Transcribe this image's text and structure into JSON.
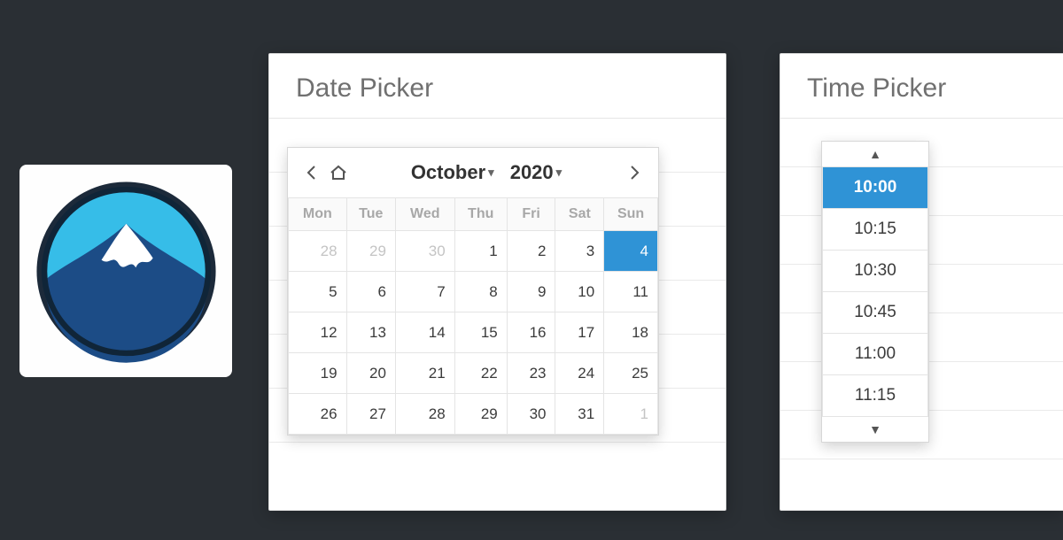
{
  "colors": {
    "accent": "#2f93d6"
  },
  "logo": {
    "name": "mountain-logo"
  },
  "date_picker": {
    "title": "Date Picker",
    "month_label": "October",
    "year_label": "2020",
    "selected_day": 4,
    "weekday_headers": [
      "Mon",
      "Tue",
      "Wed",
      "Thu",
      "Fri",
      "Sat",
      "Sun"
    ],
    "weeks": [
      [
        {
          "d": 28,
          "other": true
        },
        {
          "d": 29,
          "other": true
        },
        {
          "d": 30,
          "other": true
        },
        {
          "d": 1
        },
        {
          "d": 2
        },
        {
          "d": 3
        },
        {
          "d": 4,
          "selected": true
        }
      ],
      [
        {
          "d": 5
        },
        {
          "d": 6
        },
        {
          "d": 7
        },
        {
          "d": 8
        },
        {
          "d": 9
        },
        {
          "d": 10
        },
        {
          "d": 11
        }
      ],
      [
        {
          "d": 12
        },
        {
          "d": 13
        },
        {
          "d": 14
        },
        {
          "d": 15
        },
        {
          "d": 16
        },
        {
          "d": 17
        },
        {
          "d": 18
        }
      ],
      [
        {
          "d": 19
        },
        {
          "d": 20
        },
        {
          "d": 21
        },
        {
          "d": 22
        },
        {
          "d": 23
        },
        {
          "d": 24
        },
        {
          "d": 25
        }
      ],
      [
        {
          "d": 26
        },
        {
          "d": 27
        },
        {
          "d": 28
        },
        {
          "d": 29
        },
        {
          "d": 30
        },
        {
          "d": 31
        },
        {
          "d": 1,
          "other": true
        }
      ]
    ]
  },
  "time_picker": {
    "title": "Time Picker",
    "selected": "10:00",
    "options": [
      "10:00",
      "10:15",
      "10:30",
      "10:45",
      "11:00",
      "11:15"
    ]
  }
}
